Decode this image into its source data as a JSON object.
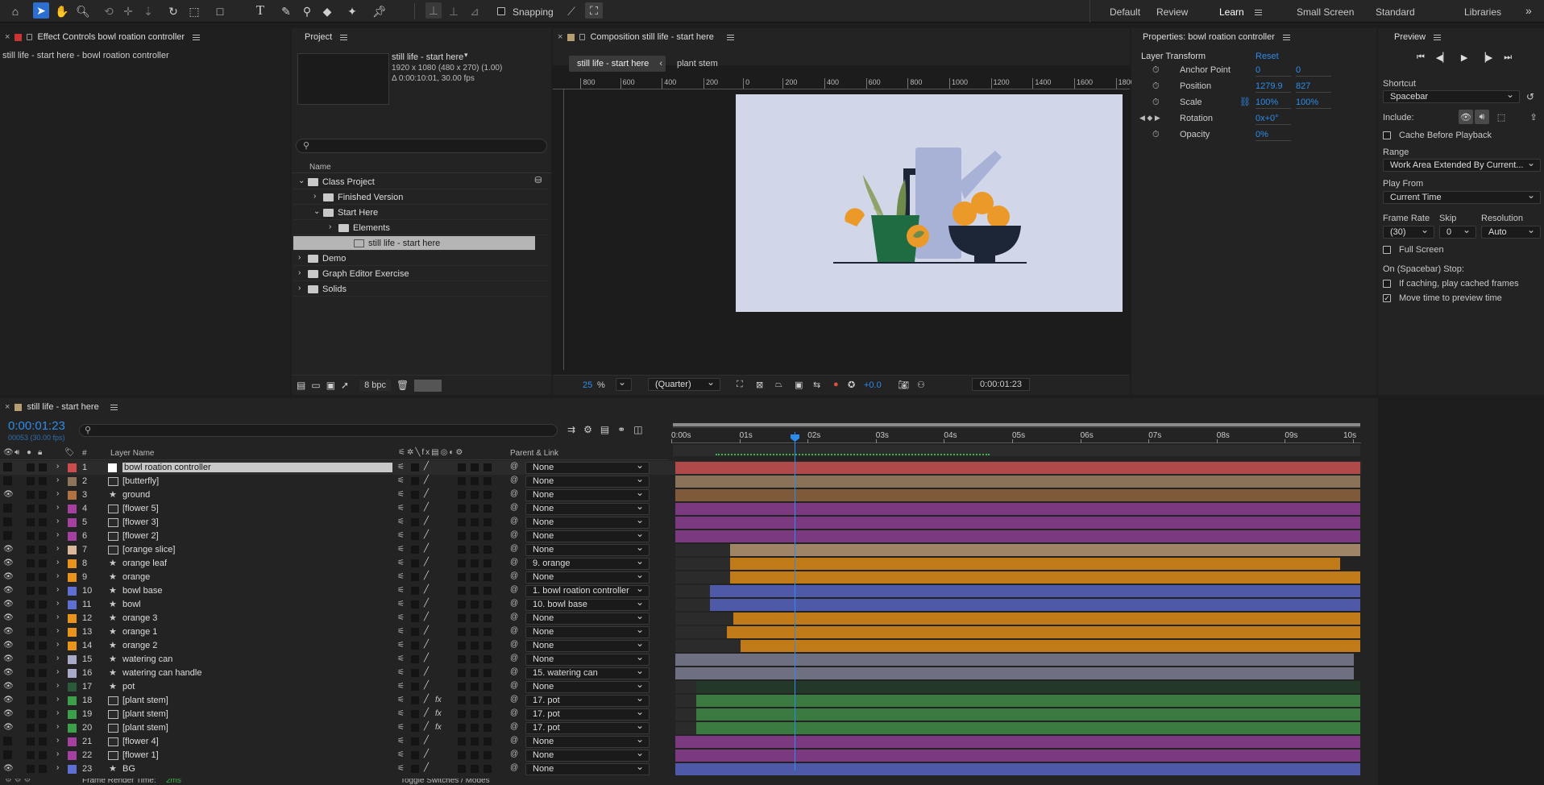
{
  "toolbar": {
    "snapping_label": "Snapping"
  },
  "workspaces": [
    "Default",
    "Review",
    "Learn",
    "Small Screen",
    "Standard",
    "Libraries"
  ],
  "active_workspace": "Learn",
  "effect_controls": {
    "title": "Effect Controls bowl roation controller",
    "subtitle": "still life - start here - bowl roation controller"
  },
  "project": {
    "title": "Project",
    "comp_name": "still life - start here",
    "comp_size": "1920 x 1080  (480 x 270) (1.00)",
    "comp_duration": "Δ 0:00:10:01, 30.00 fps",
    "search_placeholder": "",
    "col_name": "Name",
    "bpc": "8 bpc",
    "tree": [
      {
        "label": "Class Project",
        "indent": 0,
        "arrow": "v"
      },
      {
        "label": "Finished Version",
        "indent": 1,
        "arrow": ">"
      },
      {
        "label": "Start Here",
        "indent": 1,
        "arrow": "v"
      },
      {
        "label": "Elements",
        "indent": 2,
        "arrow": ">"
      },
      {
        "label": "still life - start here",
        "indent": 3,
        "arrow": ""
      },
      {
        "label": "Demo",
        "indent": 0,
        "arrow": ">"
      },
      {
        "label": "Graph Editor Exercise",
        "indent": 0,
        "arrow": ">"
      },
      {
        "label": "Solids",
        "indent": 0,
        "arrow": ">"
      }
    ]
  },
  "composition": {
    "title": "Composition still life - start here",
    "crumb1": "still life - start here",
    "crumb2": "plant stem",
    "zoom": "25",
    "zoom_unit": "%",
    "quality": "(Quarter)",
    "exposure": "+0.0",
    "timecode": "0:00:01:23",
    "ruler": [
      "800",
      "600",
      "400",
      "200",
      "0",
      "200",
      "400",
      "600",
      "800",
      "1000",
      "1200",
      "1400",
      "1600",
      "1800"
    ]
  },
  "properties": {
    "title": "Properties: bowl roation controller",
    "section": "Layer Transform",
    "reset": "Reset",
    "rows": [
      {
        "label": "Anchor Point",
        "v1": "0",
        "v2": "0"
      },
      {
        "label": "Position",
        "v1": "1279.9",
        "v2": "827"
      },
      {
        "label": "Scale",
        "v1": "100%",
        "v2": "100%"
      },
      {
        "label": "Rotation",
        "v1": "0x+0°",
        "v2": ""
      },
      {
        "label": "Opacity",
        "v1": "0%",
        "v2": ""
      }
    ]
  },
  "preview": {
    "title": "Preview",
    "shortcut_label": "Shortcut",
    "shortcut": "Spacebar",
    "include_label": "Include:",
    "cache_before": "Cache Before Playback",
    "range_label": "Range",
    "range": "Work Area Extended By Current...",
    "play_from_label": "Play From",
    "play_from": "Current Time",
    "frame_rate_label": "Frame Rate",
    "skip_label": "Skip",
    "resolution_label": "Resolution",
    "frame_rate": "(30)",
    "skip": "0",
    "resolution": "Auto",
    "full_screen": "Full Screen",
    "stop_label": "On (Spacebar) Stop:",
    "if_caching": "If caching, play cached frames",
    "move_time": "Move time to preview time"
  },
  "timeline": {
    "title": "still life - start here",
    "timecode": "0:00:01:23",
    "fps": "00053 (30.00 fps)",
    "col_num": "#",
    "col_name": "Layer Name",
    "col_parent": "Parent & Link",
    "ticks": [
      "0:00s",
      "01s",
      "02s",
      "03s",
      "04s",
      "05s",
      "06s",
      "07s",
      "08s",
      "09s",
      "10s"
    ],
    "footer_left": "Frame Render Time:",
    "footer_time": "2ms",
    "footer_mid": "Toggle Switches / Modes",
    "layers": [
      {
        "n": "1",
        "name": "bowl roation controller",
        "color": "#cc4b4b",
        "sw": "#ffffff",
        "icon": "",
        "parent": "None",
        "start": 0.0,
        "end": 1.0,
        "bar": "#b04949",
        "eye": false,
        "sel": true
      },
      {
        "n": "2",
        "name": "[butterfly]",
        "color": "#8c7558",
        "sw": "#9c7d5c",
        "icon": "comp",
        "parent": "None",
        "start": 0.0,
        "end": 1.0,
        "bar": "#8a7259",
        "eye": false
      },
      {
        "n": "3",
        "name": "ground",
        "color": "#b07240",
        "sw": "#b07240",
        "icon": "star",
        "parent": "None",
        "start": 0.0,
        "end": 1.0,
        "bar": "#7f5a3a",
        "eye": true
      },
      {
        "n": "4",
        "name": "[flower 5]",
        "color": "#a640a0",
        "sw": "#a640a0",
        "icon": "comp",
        "parent": "None",
        "start": 0.0,
        "end": 1.0,
        "bar": "#7b3a7f",
        "eye": false
      },
      {
        "n": "5",
        "name": "[flower 3]",
        "color": "#a640a0",
        "sw": "#a640a0",
        "icon": "comp",
        "parent": "None",
        "start": 0.0,
        "end": 1.0,
        "bar": "#7b3a7f",
        "eye": false
      },
      {
        "n": "6",
        "name": "[flower 2]",
        "color": "#a640a0",
        "sw": "#a640a0",
        "icon": "comp",
        "parent": "None",
        "start": 0.0,
        "end": 1.0,
        "bar": "#7b3a7f",
        "eye": false
      },
      {
        "n": "7",
        "name": "[orange slice]",
        "color": "#d9b99a",
        "sw": "#d9b99a",
        "icon": "comp",
        "parent": "None",
        "start": 0.08,
        "end": 1.0,
        "bar": "#a08466",
        "eye": true
      },
      {
        "n": "8",
        "name": "orange leaf",
        "color": "#e8941a",
        "sw": "#e8941a",
        "icon": "star",
        "parent": "9. orange",
        "start": 0.08,
        "end": 0.97,
        "bar": "#c07a17",
        "eye": true
      },
      {
        "n": "9",
        "name": "orange",
        "color": "#e8941a",
        "sw": "#e8941a",
        "icon": "star",
        "parent": "None",
        "start": 0.08,
        "end": 1.0,
        "bar": "#c07a17",
        "eye": true
      },
      {
        "n": "10",
        "name": "bowl base",
        "color": "#5e6ed2",
        "sw": "#5e6ed2",
        "icon": "star",
        "parent": "1. bowl roation controller",
        "start": 0.05,
        "end": 1.0,
        "bar": "#4e5aa8",
        "eye": true
      },
      {
        "n": "11",
        "name": "bowl",
        "color": "#5e6ed2",
        "sw": "#5e6ed2",
        "icon": "star",
        "parent": "10. bowl base",
        "start": 0.05,
        "end": 1.0,
        "bar": "#4e5aa8",
        "eye": true
      },
      {
        "n": "12",
        "name": "orange 3",
        "color": "#e8941a",
        "sw": "#e8941a",
        "icon": "star",
        "parent": "None",
        "start": 0.085,
        "end": 1.0,
        "bar": "#c07a17",
        "eye": true
      },
      {
        "n": "13",
        "name": "orange 1",
        "color": "#e8941a",
        "sw": "#e8941a",
        "icon": "star",
        "parent": "None",
        "start": 0.075,
        "end": 1.0,
        "bar": "#c07a17",
        "eye": true
      },
      {
        "n": "14",
        "name": "orange 2",
        "color": "#e8941a",
        "sw": "#e8941a",
        "icon": "star",
        "parent": "None",
        "start": 0.095,
        "end": 1.0,
        "bar": "#c07a17",
        "eye": true
      },
      {
        "n": "15",
        "name": "watering can",
        "color": "#a8aac8",
        "sw": "#a8aac8",
        "icon": "star",
        "parent": "None",
        "start": 0.0,
        "end": 0.99,
        "bar": "#6e6f80",
        "eye": true
      },
      {
        "n": "16",
        "name": "watering can handle",
        "color": "#a8aac8",
        "sw": "#a8aac8",
        "icon": "star",
        "parent": "15. watering can",
        "start": 0.0,
        "end": 0.99,
        "bar": "#6e6f80",
        "eye": true
      },
      {
        "n": "17",
        "name": "pot",
        "color": "#2a5a3a",
        "sw": "#2a5a3a",
        "icon": "star",
        "parent": "None",
        "start": 0.03,
        "end": 1.0,
        "bar": "#243829",
        "eye": true
      },
      {
        "n": "18",
        "name": "[plant stem]",
        "color": "#3ca04a",
        "sw": "#3ca04a",
        "icon": "comp",
        "parent": "17. pot",
        "start": 0.03,
        "end": 1.0,
        "bar": "#3a7a40",
        "eye": true,
        "fx": true
      },
      {
        "n": "19",
        "name": "[plant stem]",
        "color": "#3ca04a",
        "sw": "#3ca04a",
        "icon": "comp",
        "parent": "17. pot",
        "start": 0.03,
        "end": 1.0,
        "bar": "#3a7a40",
        "eye": true,
        "fx": true
      },
      {
        "n": "20",
        "name": "[plant stem]",
        "color": "#3ca04a",
        "sw": "#3ca04a",
        "icon": "comp",
        "parent": "17. pot",
        "start": 0.03,
        "end": 1.0,
        "bar": "#3a7a40",
        "eye": true,
        "fx": true
      },
      {
        "n": "21",
        "name": "[flower 4]",
        "color": "#a640a0",
        "sw": "#a640a0",
        "icon": "comp",
        "parent": "None",
        "start": 0.0,
        "end": 1.0,
        "bar": "#7b3a7f",
        "eye": false
      },
      {
        "n": "22",
        "name": "[flower 1]",
        "color": "#a640a0",
        "sw": "#a640a0",
        "icon": "comp",
        "parent": "None",
        "start": 0.0,
        "end": 1.0,
        "bar": "#7b3a7f",
        "eye": false
      },
      {
        "n": "23",
        "name": "BG",
        "color": "#5e6ed2",
        "sw": "#5e6ed2",
        "icon": "star",
        "parent": "None",
        "start": 0.0,
        "end": 1.0,
        "bar": "#4e5aa8",
        "eye": true
      }
    ]
  }
}
